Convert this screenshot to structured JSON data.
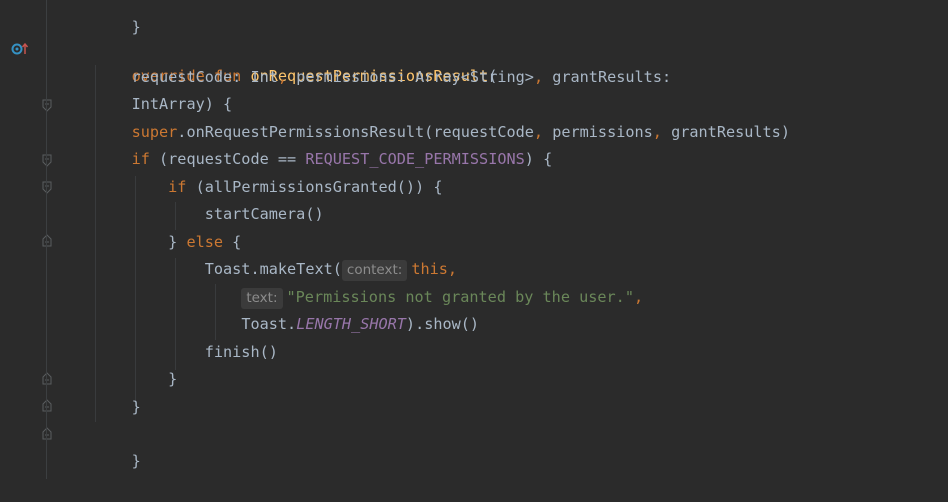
{
  "code": {
    "top_brace": "}",
    "l1": {
      "override": "override",
      "fun": "fun",
      "name": "onRequestPermissionsResult",
      "open": "("
    },
    "l2": {
      "p1": "requestCode",
      "c1": ": Int",
      "comma1": ",",
      "p2": " permissions",
      "c2": ": Array<String>",
      "comma2": ",",
      "p3": " grantResults",
      "c3": ":"
    },
    "l3": {
      "text": "IntArray) {"
    },
    "l4": {
      "super": "super",
      "call": ".onRequestPermissionsResult(requestCode",
      "comma1": ",",
      "arg2": " permissions",
      "comma2": ",",
      "arg3": " grantResults)"
    },
    "l5": {
      "if": "if",
      "a": " (requestCode == ",
      "const": "REQUEST_CODE_PERMISSIONS",
      "b": ") {"
    },
    "l6": {
      "if": "if",
      "rest": " (allPermissionsGranted()) {"
    },
    "l7": {
      "text": "startCamera()"
    },
    "l8": {
      "close": "} ",
      "else": "else",
      "open": " {"
    },
    "l9": {
      "call": "Toast.makeText(",
      "hint": "context:",
      "this": "this",
      "comma": ","
    },
    "l10": {
      "hint": "text:",
      "str": "\"Permissions not granted by the user.\"",
      "comma": ","
    },
    "l11": {
      "a": "Toast.",
      "const": "LENGTH_SHORT",
      "b": ").show()"
    },
    "l12": {
      "text": "finish()"
    },
    "l13": {
      "text": "}"
    },
    "l14": {
      "text": "}"
    },
    "l15": {
      "text": "}"
    }
  },
  "gutter": {
    "override_icon": "override-up-arrow-icon",
    "fold_icon": "fold-marker-icon"
  },
  "colors": {
    "background": "#2b2b2b",
    "keyword": "#cc7832",
    "function": "#ffc66d",
    "constant": "#9876aa",
    "string": "#6a8759",
    "default": "#a9b7c6"
  }
}
